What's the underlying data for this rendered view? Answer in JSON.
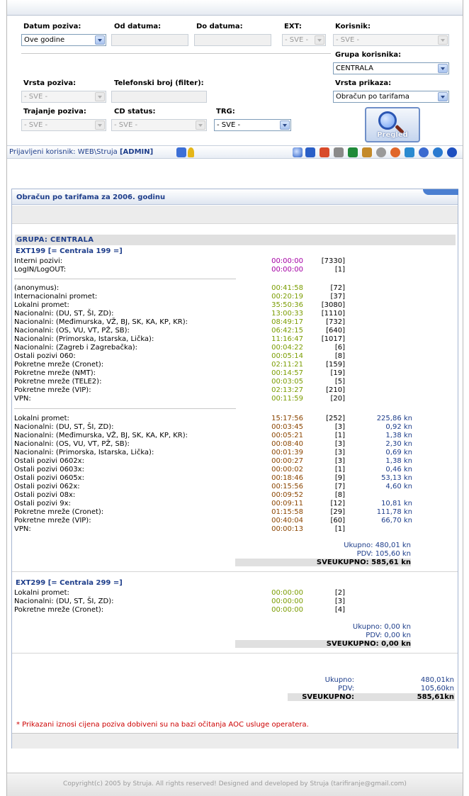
{
  "filters": {
    "datum_poziva": {
      "label": "Datum poziva:",
      "value": "Ove godine"
    },
    "od_datuma": {
      "label": "Od datuma:",
      "value": ""
    },
    "do_datuma": {
      "label": "Do datuma:",
      "value": ""
    },
    "ext": {
      "label": "EXT:",
      "value": "- SVE -"
    },
    "korisnik": {
      "label": "Korisnik:",
      "value": "- SVE -"
    },
    "grupa_korisnika": {
      "label": "Grupa korisnika:",
      "value": "CENTRALA"
    },
    "vrsta_poziva": {
      "label": "Vrsta poziva:",
      "value": "- SVE -"
    },
    "telefonski_broj": {
      "label": "Telefonski broj (filter):",
      "value": ""
    },
    "vrsta_prikaza": {
      "label": "Vrsta prikaza:",
      "value": "Obračun po tarifama"
    },
    "trajanje_poziva": {
      "label": "Trajanje poziva:",
      "value": "- SVE -"
    },
    "cd_status": {
      "label": "CD status:",
      "value": "- SVE -"
    },
    "trg": {
      "label": "TRG:",
      "value": "- SVE -"
    },
    "pregled_label": "Pregled"
  },
  "userbar": {
    "prefix": "Prijavljeni korisnik:",
    "user": "WEB\\Struja",
    "role": "[ADMIN]"
  },
  "icons": [
    "search-icon",
    "book-icon",
    "home-icon",
    "print-icon",
    "excel-icon",
    "users-icon",
    "settings-icon",
    "clock-icon",
    "refresh-icon",
    "database-icon",
    "globe-icon",
    "help-icon"
  ],
  "panel": {
    "title": "Obračun po tarifama za 2006. godinu",
    "group": "GRUPA: CENTRALA",
    "ext1": {
      "header": "EXT199 [= Centrala 199 =]",
      "internal": [
        {
          "name": "Interni pozivi:",
          "time": "00:00:00",
          "count": "[7330]"
        },
        {
          "name": "LogIN/LogOUT:",
          "time": "00:00:00",
          "count": "[1]"
        }
      ],
      "free": [
        {
          "name": "(anonymus):",
          "time": "00:41:58",
          "count": "[72]"
        },
        {
          "name": "Internacionalni promet:",
          "time": "00:20:19",
          "count": "[37]"
        },
        {
          "name": "Lokalni promet:",
          "time": "35:50:36",
          "count": "[3080]"
        },
        {
          "name": "Nacionalni: (DU, ST, ŠI, ZD):",
          "time": "13:00:33",
          "count": "[1110]"
        },
        {
          "name": "Nacionalni: (Međimurska, VŽ, BJ, SK, KA, KP, KR):",
          "time": "08:49:17",
          "count": "[732]"
        },
        {
          "name": "Nacionalni: (OS, VU, VT, PŽ, SB):",
          "time": "06:42:15",
          "count": "[640]"
        },
        {
          "name": "Nacionalni: (Primorska, Istarska, Lička):",
          "time": "11:16:47",
          "count": "[1017]"
        },
        {
          "name": "Nacionalni: (Zagreb i Zagrebačka):",
          "time": "00:04:22",
          "count": "[6]"
        },
        {
          "name": "Ostali pozivi 060:",
          "time": "00:05:14",
          "count": "[8]"
        },
        {
          "name": "Pokretne mreže (Cronet):",
          "time": "02:11:21",
          "count": "[159]"
        },
        {
          "name": "Pokretne mreže (NMT):",
          "time": "00:14:57",
          "count": "[19]"
        },
        {
          "name": "Pokretne mreže (TELE2):",
          "time": "00:03:05",
          "count": "[5]"
        },
        {
          "name": "Pokretne mreže (VIP):",
          "time": "02:13:27",
          "count": "[210]"
        },
        {
          "name": "VPN:",
          "time": "00:11:59",
          "count": "[20]"
        }
      ],
      "paid": [
        {
          "name": "Lokalni promet:",
          "time": "15:17:56",
          "count": "[252]",
          "price": "225,86 kn"
        },
        {
          "name": "Nacionalni: (DU, ST, ŠI, ZD):",
          "time": "00:03:45",
          "count": "[3]",
          "price": "0,92 kn"
        },
        {
          "name": "Nacionalni: (Međimurska, VŽ, BJ, SK, KA, KP, KR):",
          "time": "00:05:21",
          "count": "[1]",
          "price": "1,38 kn"
        },
        {
          "name": "Nacionalni: (OS, VU, VT, PŽ, SB):",
          "time": "00:08:40",
          "count": "[3]",
          "price": "2,30 kn"
        },
        {
          "name": "Nacionalni: (Primorska, Istarska, Lička):",
          "time": "00:01:39",
          "count": "[3]",
          "price": "0,69 kn"
        },
        {
          "name": "Ostali pozivi 0602x:",
          "time": "00:00:27",
          "count": "[3]",
          "price": "1,38 kn"
        },
        {
          "name": "Ostali pozivi 0603x:",
          "time": "00:00:02",
          "count": "[1]",
          "price": "0,46 kn"
        },
        {
          "name": "Ostali pozivi 0605x:",
          "time": "00:18:46",
          "count": "[9]",
          "price": "53,13 kn"
        },
        {
          "name": "Ostali pozivi 062x:",
          "time": "00:15:56",
          "count": "[7]",
          "price": "4,60 kn"
        },
        {
          "name": "Ostali pozivi 08x:",
          "time": "00:09:52",
          "count": "[8]",
          "price": ""
        },
        {
          "name": "Ostali pozivi 9x:",
          "time": "00:09:11",
          "count": "[12]",
          "price": "10,81 kn"
        },
        {
          "name": "Pokretne mreže (Cronet):",
          "time": "01:15:58",
          "count": "[29]",
          "price": "111,78 kn"
        },
        {
          "name": "Pokretne mreže (VIP):",
          "time": "00:40:04",
          "count": "[60]",
          "price": "66,70 kn"
        },
        {
          "name": "VPN:",
          "time": "00:00:13",
          "count": "[1]",
          "price": ""
        }
      ],
      "ukupno": "Ukupno: 480,01 kn",
      "pdv": "PDV: 105,60 kn",
      "sveukupno": "SVEUKUPNO: 585,61 kn"
    },
    "ext2": {
      "header": "EXT299 [= Centrala 299 =]",
      "rows": [
        {
          "name": "Lokalni promet:",
          "time": "00:00:00",
          "count": "[2]"
        },
        {
          "name": "Nacionalni: (DU, ST, ŠI, ZD):",
          "time": "00:00:00",
          "count": "[3]"
        },
        {
          "name": "Pokretne mreže (Cronet):",
          "time": "00:00:00",
          "count": "[4]"
        }
      ],
      "ukupno": "Ukupno: 0,00 kn",
      "pdv": "PDV: 0,00 kn",
      "sveukupno": "SVEUKUPNO: 0,00 kn"
    },
    "grand": {
      "ukupno_label": "Ukupno:",
      "ukupno_value": "480,01kn",
      "pdv_label": "PDV:",
      "pdv_value": "105,60kn",
      "sveukupno_label": "SVEUKUPNO:",
      "sveukupno_value": "585,61kn"
    },
    "note": "* Prikazani iznosi cijena poziva dobiveni su na bazi očitanja AOC usluge operatera."
  },
  "footer": "Copyright(c) 2005 by Struja. All rights reserved! Designed and developed by Struja (tarifiranje@gmail.com)",
  "colors": {
    "accent": "#1d3d8a",
    "magenta": "#a400a4",
    "green": "#7a9c00",
    "brown": "#8b4500",
    "note": "#cc0000"
  }
}
